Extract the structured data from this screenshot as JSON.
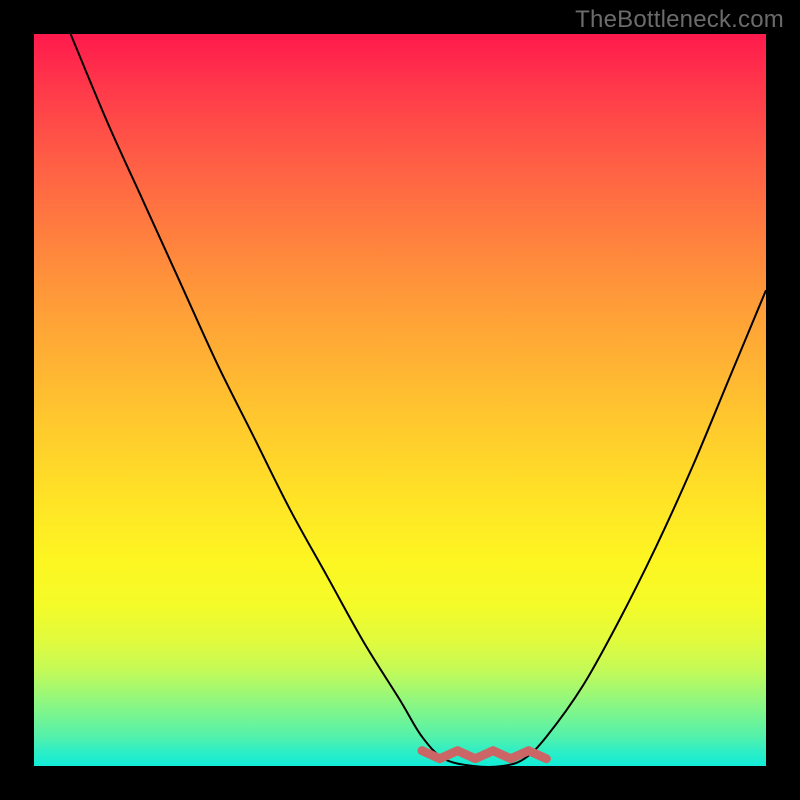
{
  "watermark": "TheBottleneck.com",
  "colors": {
    "frame": "#000000",
    "curve": "#000000",
    "trough": "#cc6666"
  },
  "chart_data": {
    "type": "line",
    "title": "",
    "xlabel": "",
    "ylabel": "",
    "xlim": [
      0,
      100
    ],
    "ylim": [
      0,
      100
    ],
    "series": [
      {
        "name": "bottleneck-curve",
        "x": [
          5,
          10,
          15,
          20,
          25,
          30,
          35,
          40,
          45,
          50,
          53,
          56,
          60,
          64,
          67,
          70,
          75,
          80,
          85,
          90,
          95,
          100
        ],
        "values": [
          100,
          88,
          77,
          66,
          55,
          45,
          35,
          26,
          17,
          9,
          4,
          1,
          0,
          0,
          1,
          4,
          11,
          20,
          30,
          41,
          53,
          65
        ]
      }
    ],
    "annotations": [
      {
        "name": "optimal-trough",
        "x_range": [
          53,
          70
        ],
        "y": 1
      }
    ],
    "background_gradient_stops": [
      {
        "pos": 0,
        "color": "#ff1a4d"
      },
      {
        "pos": 25,
        "color": "#ff7740"
      },
      {
        "pos": 54,
        "color": "#ffcb2d"
      },
      {
        "pos": 78,
        "color": "#f4fb28"
      },
      {
        "pos": 90,
        "color": "#9ef874"
      },
      {
        "pos": 100,
        "color": "#12ecd8"
      }
    ]
  }
}
